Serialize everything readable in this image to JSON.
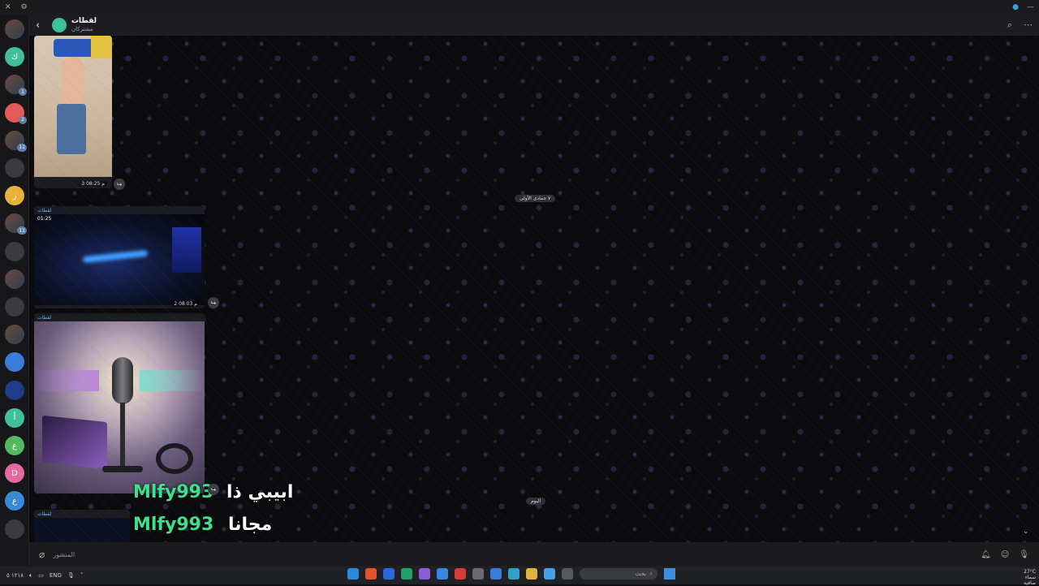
{
  "header": {
    "title": "لقطات",
    "subtitle": "مشتركان"
  },
  "posts": [
    {
      "channel": "",
      "meta": "3 08:25 م",
      "duration": ""
    },
    {
      "channel": "لقطات",
      "meta": "2 08:03 م",
      "duration": "01:25"
    },
    {
      "channel": "لقطات",
      "meta": "",
      "duration": ""
    },
    {
      "channel": "لقطات",
      "meta": "",
      "duration": ""
    }
  ],
  "date_pills": {
    "top": "٧ جمادى الأولى",
    "bottom": "اليوم"
  },
  "overlay": {
    "line1_ar": "ابيبي ذا",
    "line1_handle": "Mlfy993",
    "line2_ar": "مجانا",
    "line2_handle": "Mlfy993"
  },
  "composer": {
    "placeholder": "المنشور"
  },
  "rail_items": [
    {
      "letter": "",
      "badge": ""
    },
    {
      "letter": "ك",
      "badge": ""
    },
    {
      "letter": "",
      "badge": "1"
    },
    {
      "letter": "",
      "badge": "2"
    },
    {
      "letter": "",
      "badge": "11"
    },
    {
      "letter": "",
      "badge": ""
    },
    {
      "letter": "ز",
      "badge": ""
    },
    {
      "letter": "",
      "badge": "11"
    },
    {
      "letter": "",
      "badge": ""
    },
    {
      "letter": "",
      "badge": ""
    },
    {
      "letter": "",
      "badge": ""
    },
    {
      "letter": "",
      "badge": ""
    },
    {
      "letter": "",
      "badge": ""
    },
    {
      "letter": "",
      "badge": ""
    },
    {
      "letter": "أ",
      "badge": ""
    },
    {
      "letter": "ع",
      "badge": ""
    },
    {
      "letter": "D",
      "badge": ""
    },
    {
      "letter": "ع",
      "badge": ""
    },
    {
      "letter": "",
      "badge": ""
    }
  ],
  "taskbar": {
    "lang": "ENG",
    "search_label": "بحث",
    "weather": "27°C",
    "weather_sub": "سماء صافية",
    "tray_text": "١٢١٨ ٥"
  },
  "colors": {
    "accent": "#3fbf9a",
    "overlay_green": "#3ee08a",
    "link": "#6fb0e8"
  }
}
